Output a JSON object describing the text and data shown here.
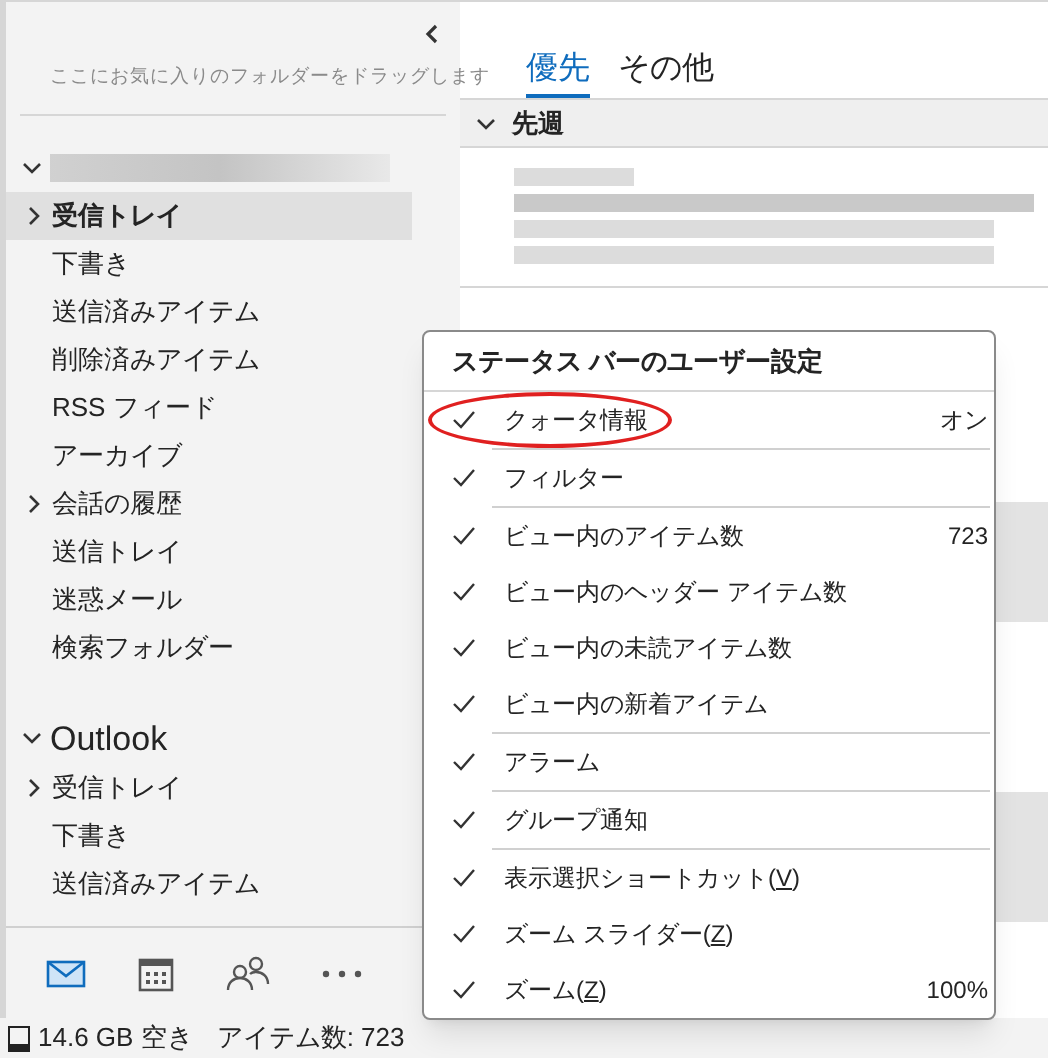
{
  "favorites": {
    "hint": "ここにお気に入りのフォルダーをドラッグします"
  },
  "accounts": [
    {
      "expanded": true,
      "folders": [
        {
          "name": "受信トレイ",
          "has_children": true,
          "selected": true
        },
        {
          "name": "下書き",
          "has_children": false,
          "selected": false
        },
        {
          "name": "送信済みアイテム",
          "has_children": false,
          "selected": false
        },
        {
          "name": "削除済みアイテム",
          "has_children": false,
          "selected": false
        },
        {
          "name": "RSS フィード",
          "has_children": false,
          "selected": false
        },
        {
          "name": "アーカイブ",
          "has_children": false,
          "selected": false
        },
        {
          "name": "会話の履歴",
          "has_children": true,
          "selected": false
        },
        {
          "name": "送信トレイ",
          "has_children": false,
          "selected": false
        },
        {
          "name": "迷惑メール",
          "has_children": false,
          "selected": false
        },
        {
          "name": "検索フォルダー",
          "has_children": false,
          "selected": false
        }
      ]
    },
    {
      "name": "Outlook",
      "expanded": true,
      "folders": [
        {
          "name": "受信トレイ",
          "has_children": true,
          "selected": false
        },
        {
          "name": "下書き",
          "has_children": false,
          "selected": false
        },
        {
          "name": "送信済みアイテム",
          "has_children": false,
          "selected": false
        }
      ]
    }
  ],
  "nav": [
    {
      "kind": "mail",
      "selected": true
    },
    {
      "kind": "calendar",
      "selected": false
    },
    {
      "kind": "people",
      "selected": false
    },
    {
      "kind": "more",
      "selected": false
    }
  ],
  "tabs": [
    {
      "label": "優先",
      "selected": true
    },
    {
      "label": "その他",
      "selected": false
    }
  ],
  "group_header": {
    "label": "先週",
    "expanded": true
  },
  "menu": {
    "title": "ステータス バーのユーザー設定",
    "groups": [
      [
        {
          "label": "クォータ情報",
          "checked": true,
          "value": "オン",
          "circled": true
        }
      ],
      [
        {
          "label": "フィルター",
          "checked": true
        }
      ],
      [
        {
          "label": "ビュー内のアイテム数",
          "checked": true,
          "value": "723"
        },
        {
          "label": "ビュー内のヘッダー アイテム数",
          "checked": true
        },
        {
          "label": "ビュー内の未読アイテム数",
          "checked": true
        },
        {
          "label": "ビュー内の新着アイテム",
          "checked": true
        }
      ],
      [
        {
          "label": "アラーム",
          "checked": true
        }
      ],
      [
        {
          "label": "グループ通知",
          "checked": true
        }
      ],
      [
        {
          "label": "表示選択ショートカット(V)",
          "checked": true,
          "access_key": true
        },
        {
          "label": "ズーム スライダー(Z)",
          "checked": true,
          "access_key": true
        },
        {
          "label": "ズーム(Z)",
          "checked": true,
          "access_key": true,
          "value": "100%"
        }
      ]
    ]
  },
  "status_bar": {
    "quota": "14.6 GB 空き",
    "item_count": "アイテム数: 723"
  }
}
